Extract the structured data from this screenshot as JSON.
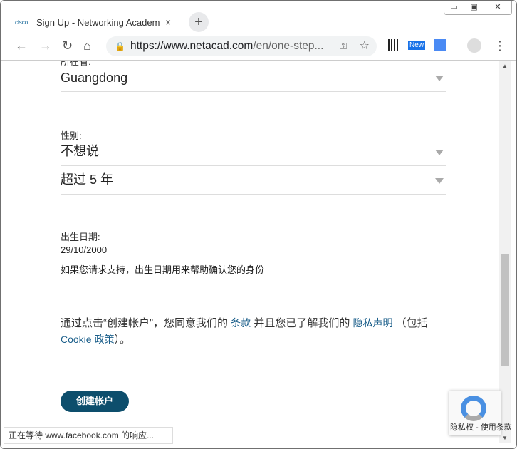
{
  "window": {
    "minimize": "▭",
    "maximize": "▣",
    "close": "✕"
  },
  "tab": {
    "favicon": "cisco",
    "title": "Sign Up - Networking Academ",
    "close": "×",
    "new_tab": "+"
  },
  "toolbar": {
    "back": "←",
    "forward": "→",
    "reload": "↻",
    "home": "⌂",
    "url_host": "https://www.netacad.com",
    "url_rest": "/en/one-step...",
    "ext_new": "New",
    "menu": "⋮"
  },
  "form": {
    "province_label": "所在省:",
    "province_value": "Guangdong",
    "gender_label": "性别:",
    "gender_value": "不想说",
    "experience_value": "超过 5 年",
    "dob_label": "出生日期:",
    "dob_value": "29/10/2000",
    "dob_hint": "如果您请求支持，出生日期用来帮助确认您的身份",
    "agree_1": "通过点击“创建帐户”，您同意我们的 ",
    "terms": "条款",
    "agree_2": " 并且您已了解我们的 ",
    "privacy": "隐私声明",
    "agree_3": " （包括 ",
    "cookie": "Cookie 政策",
    "agree_4": "）。",
    "submit": "创建帐户"
  },
  "recaptcha": {
    "text": "隐私权 - 使用条款"
  },
  "status": "正在等待 www.facebook.com 的响应..."
}
